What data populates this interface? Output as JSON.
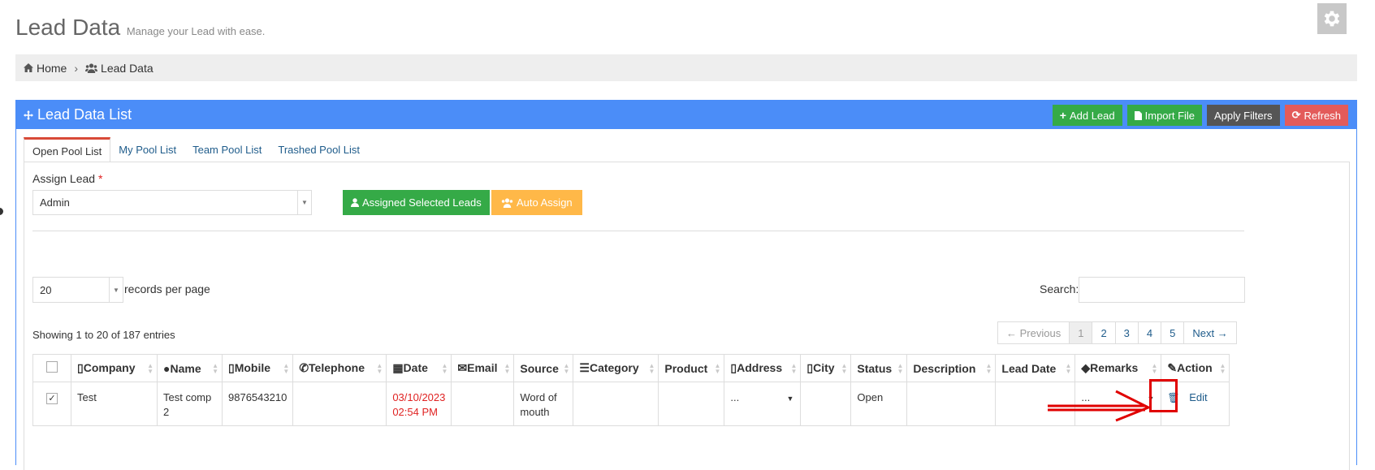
{
  "page": {
    "title": "Lead Data",
    "subtitle": "Manage your Lead with ease."
  },
  "breadcrumb": [
    {
      "label": "Home",
      "icon": "home-icon"
    },
    {
      "label": "Lead Data",
      "icon": "users-icon"
    }
  ],
  "portlet": {
    "title": "Lead Data List",
    "actions": {
      "add_lead": "Add Lead",
      "import_file": "Import File",
      "apply_filters": "Apply Filters",
      "refresh": "Refresh"
    }
  },
  "tabs": [
    "Open Pool List",
    "My Pool List",
    "Team Pool List",
    "Trashed Pool List"
  ],
  "assign": {
    "label": "Assign Lead",
    "required_mark": "*",
    "selected": "Admin",
    "assigned_selected_button": "Assigned Selected Leads",
    "auto_assign_button": "Auto Assign"
  },
  "table_controls": {
    "records_per_page_value": "20",
    "records_per_page_label": "records per page",
    "search_label": "Search:",
    "showing": "Showing 1 to 20 of 187 entries",
    "pagination": {
      "previous": "← Previous",
      "pages": [
        "1",
        "2",
        "3",
        "4",
        "5"
      ],
      "active_page": "1",
      "next": "Next →"
    }
  },
  "table": {
    "columns": [
      "Company",
      "Name",
      "Mobile",
      "Telephone",
      "Date",
      "Email",
      "Source",
      "Category",
      "Product",
      "Address",
      "City",
      "Status",
      "Description",
      "Lead Date",
      "Remarks",
      "Action"
    ],
    "rows": [
      {
        "checked": true,
        "company": "Test",
        "name_line1": "Test comp",
        "name_line2": "2",
        "mobile": "9876543210",
        "telephone": "",
        "date_line1": "03/10/2023",
        "date_line2": "02:54 PM",
        "email": "",
        "source_line1": "Word of",
        "source_line2": "mouth",
        "category": "",
        "product": "",
        "address": "...",
        "city": "",
        "status": "Open",
        "description": "",
        "lead_date": "",
        "remarks": "...",
        "edit": "Edit"
      }
    ]
  },
  "colors": {
    "primary": "#4b8df8",
    "green": "#35aa47",
    "dark": "#555555",
    "red": "#e35b5a",
    "yellow": "#ffb848",
    "highlight": "#e00000"
  }
}
